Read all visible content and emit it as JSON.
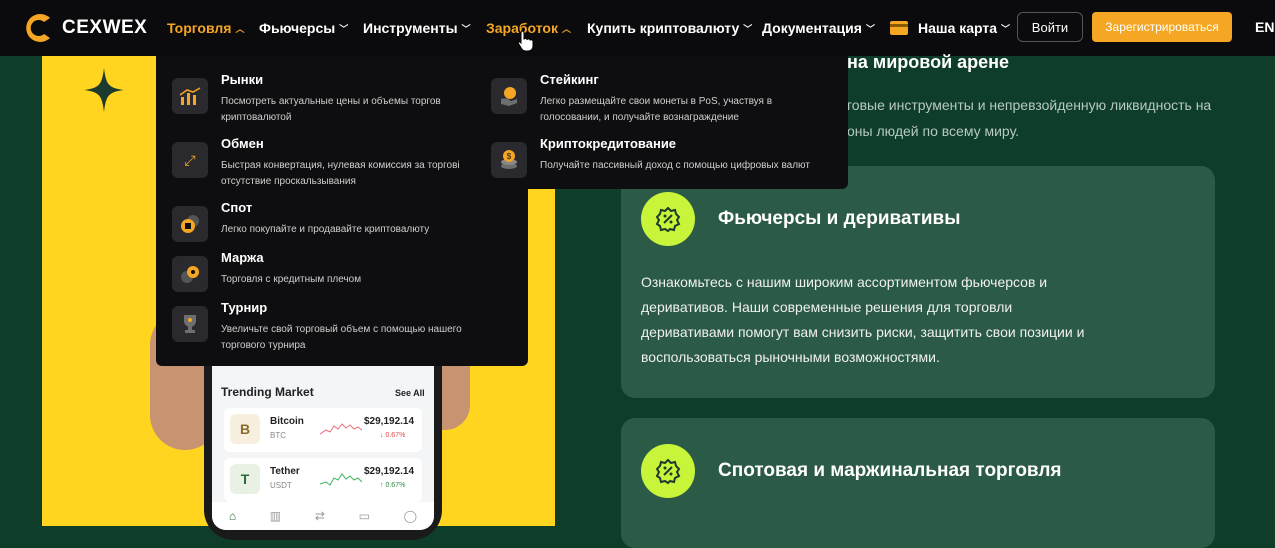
{
  "nav": {
    "logo_text": "CEXWEX",
    "items": [
      {
        "label": "Торговля",
        "chev": "^"
      },
      {
        "label": "Фьючерсы",
        "chev": "v"
      },
      {
        "label": "Инструменты",
        "chev": "v"
      },
      {
        "label": "Заработок",
        "chev": "^"
      },
      {
        "label": "Купить криптовалюту",
        "chev": "v"
      },
      {
        "label": "Документация",
        "chev": "v"
      },
      {
        "label": "Наша карта",
        "chev": "v"
      }
    ],
    "login": "Войти",
    "register": "Зарегистрироваться",
    "lang": "EN"
  },
  "trade_menu": [
    {
      "title": "Рынки",
      "desc": "Посмотреть актуальные цены и объемы торгов криптовалютой",
      "icon": "chart-icon"
    },
    {
      "title": "Обмен",
      "desc": "Быстрая конвертация, нулевая комиссия за торгові отсутствие проскальзывания",
      "icon": "exchange-icon"
    },
    {
      "title": "Спот",
      "desc": "Легко покупайте и продавайте криптовалюту",
      "icon": "spot-icon"
    },
    {
      "title": "Маржа",
      "desc": "Торговля с кредитным плечом",
      "icon": "margin-icon"
    },
    {
      "title": "Турнир",
      "desc": "Увеличьте свой торговый объем с помощью нашего торгового турнира",
      "icon": "trophy-icon"
    }
  ],
  "earn_menu": [
    {
      "title": "Стейкинг",
      "desc": "Легко размещайте свои монеты в PoS, участвуя в голосовании, и получайте вознаграждение",
      "icon": "staking-icon"
    },
    {
      "title": "Криптокредитование",
      "desc": "Получайте пассивный доход с помощью цифровых валют",
      "icon": "lending-icon"
    }
  ],
  "hero": {
    "title_fragment": "на мировой арене",
    "sub_line1": "говые инструменты и непревзойденную ликвидность на",
    "sub_line2": "оны людей по всему миру."
  },
  "phone": {
    "trending_title": "Trending Market",
    "see_all": "See All",
    "coins": [
      {
        "name": "Bitcoin",
        "symbol": "BTC",
        "price": "$29,192.14",
        "change": "↓ 0.67%",
        "direction": "down",
        "icon": "B"
      },
      {
        "name": "Tether",
        "symbol": "USDT",
        "price": "$29,192.14",
        "change": "↑ 0.67%",
        "direction": "up",
        "icon": "T"
      }
    ]
  },
  "cards": [
    {
      "title": "Фьючерсы и деривативы",
      "body": "Ознакомьтесь с нашим широким ассортиментом фьючерсов и деривативов. Наши современные решения для торговли деривативами помогут вам снизить риски, защитить свои позиции и воспользоваться рыночными возможностями.",
      "icon": "percent-badge-icon"
    },
    {
      "title": "Спотовая и маржинальная торговля",
      "body": "",
      "icon": "percent-badge-icon"
    }
  ],
  "colors": {
    "accent": "#f5a623",
    "lime": "#c8f53a",
    "bg": "#0e3d2a",
    "card": "#2b5a46",
    "yellow": "#ffd51f"
  }
}
